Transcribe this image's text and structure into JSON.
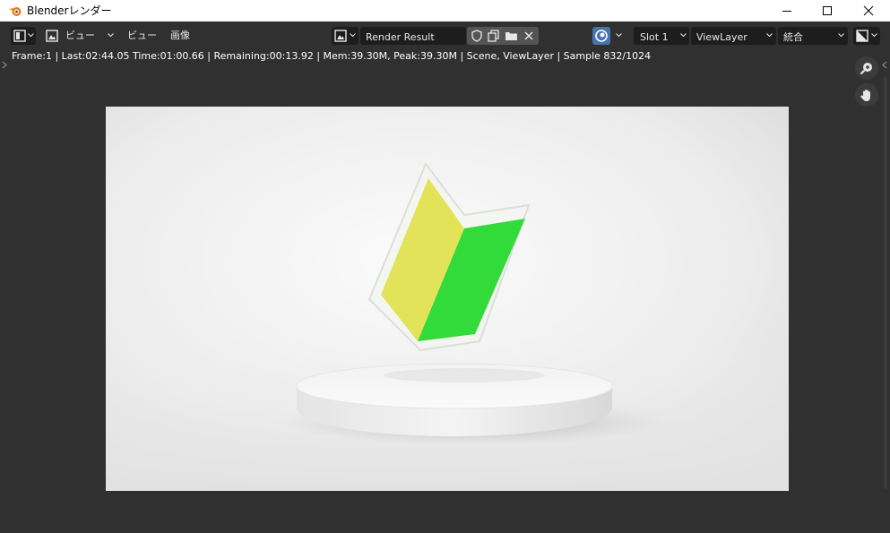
{
  "window": {
    "title": "Blenderレンダー"
  },
  "header": {
    "menu_view_label": "ビュー",
    "menu_view2_label": "ビュー",
    "menu_image_label": "画像",
    "image_name": "Render Result",
    "slot_label": "Slot 1",
    "view_layer_label": "ViewLayer",
    "pass_label": "統合"
  },
  "info": {
    "text": "Frame:1 | Last:02:44.05 Time:01:00.66 | Remaining:00:13.92 | Mem:39.30M, Peak:39.30M | Scene, ViewLayer | Sample 832/1024"
  },
  "colors": {
    "accent_blue": "#4772b3",
    "panel": "#303030",
    "field": "#1d1d1d",
    "mark_yellow": "#e3e35a",
    "mark_green": "#32db3a"
  },
  "icons": [
    "blender-logo-icon",
    "editor-type-icon",
    "image-icon",
    "shield-icon",
    "duplicate-icon",
    "folder-icon",
    "close-icon",
    "render-display-icon",
    "display-channels-icon",
    "zoom-icon",
    "hand-icon"
  ]
}
